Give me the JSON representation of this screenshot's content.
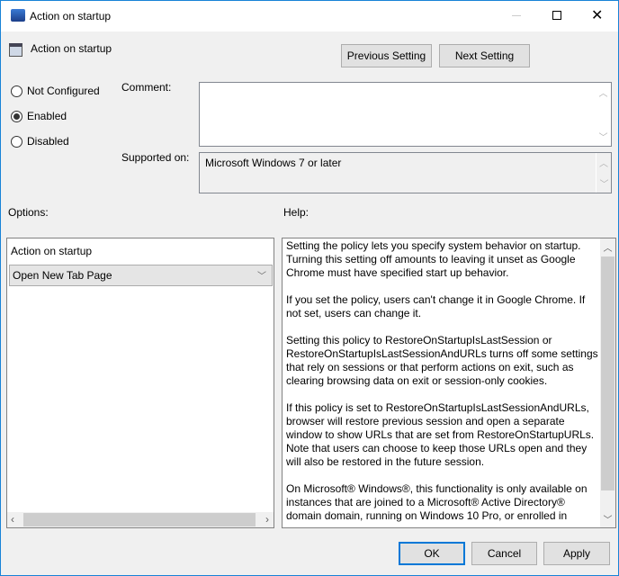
{
  "window": {
    "title": "Action on startup",
    "minimize_icon": "minimize-icon",
    "maximize_icon": "maximize-icon",
    "close_icon": "close-icon"
  },
  "header": {
    "policy_name": "Action on startup",
    "prev_label": "Previous Setting",
    "next_label": "Next Setting"
  },
  "state": {
    "options": [
      {
        "label": "Not Configured",
        "selected": false
      },
      {
        "label": "Enabled",
        "selected": true
      },
      {
        "label": "Disabled",
        "selected": false
      }
    ]
  },
  "comment": {
    "label": "Comment:",
    "value": ""
  },
  "supported": {
    "label": "Supported on:",
    "value": "Microsoft Windows 7 or later"
  },
  "options_panel": {
    "label": "Options:",
    "field_label": "Action on startup",
    "selected_value": "Open New Tab Page"
  },
  "help_panel": {
    "label": "Help:",
    "paragraphs": [
      "Setting the policy lets you specify system behavior on startup.\nTurning this setting off amounts to leaving it unset as Google\nChrome must have specified start up behavior.",
      "If you set the policy, users can't change it in Google Chrome. If\nnot set, users can change it.",
      "Setting this policy to RestoreOnStartupIsLastSession or\nRestoreOnStartupIsLastSessionAndURLs turns off some settings\nthat rely on sessions or that perform actions on exit, such as\nclearing browsing data on exit or session-only cookies.",
      "If this policy is set to RestoreOnStartupIsLastSessionAndURLs,\nbrowser will restore previous session and open a separate\nwindow to show URLs that are set from RestoreOnStartupURLs.\nNote that users can choose to keep those URLs open and they\nwill also be restored in the future session.",
      "On Microsoft® Windows®, this functionality is only available on\ninstances that are joined to a Microsoft® Active Directory®\ndomain domain, running on Windows 10 Pro, or enrolled in"
    ]
  },
  "footer": {
    "ok": "OK",
    "cancel": "Cancel",
    "apply": "Apply"
  },
  "colors": {
    "accent": "#1883d7",
    "background": "#f0f0f0"
  }
}
